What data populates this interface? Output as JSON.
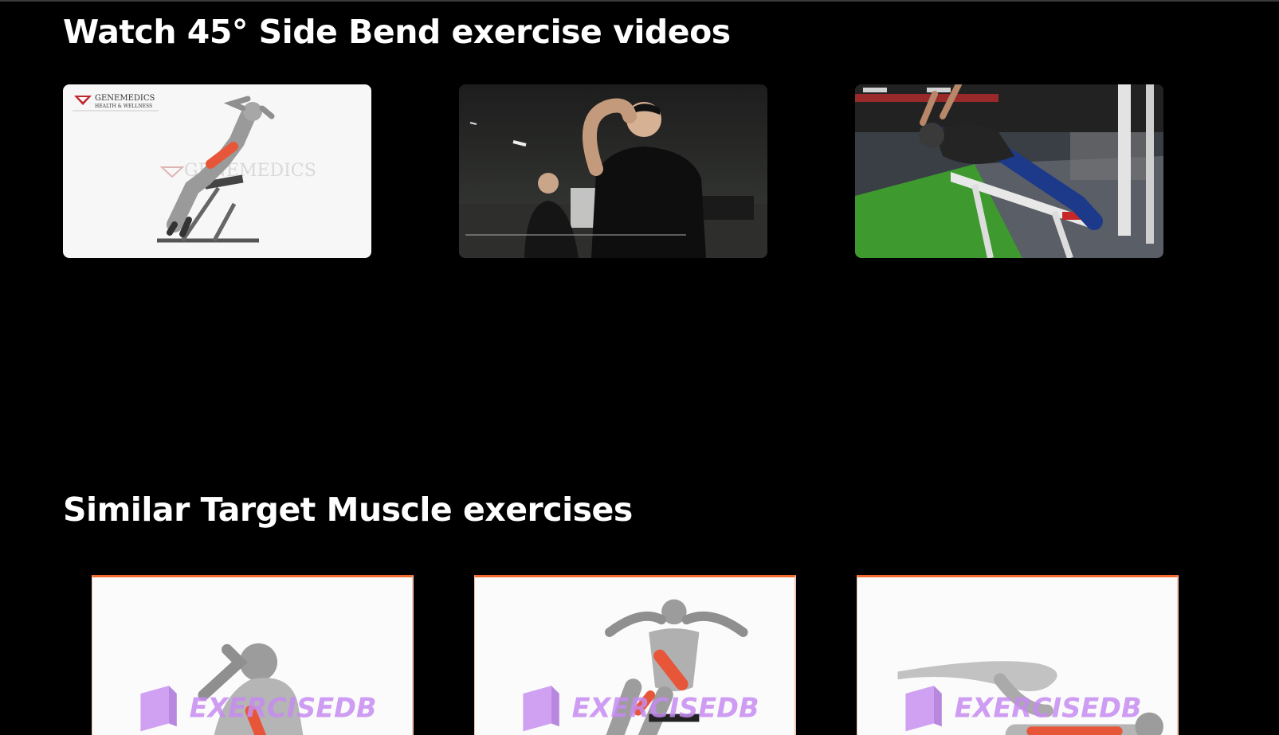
{
  "sections": {
    "videos_title": "Watch 45° Side Bend exercise videos",
    "similar_title": "Similar Target Muscle exercises"
  },
  "videos": [
    {
      "logo_text": "GENEMEDICS",
      "logo_sub": "HEALTH & WELLNESS",
      "watermark": "GENEMEDICS"
    },
    {},
    {}
  ],
  "exercise_cards": [
    {
      "watermark": "EXERCISEDB"
    },
    {
      "watermark": "EXERCISEDB"
    },
    {
      "watermark": "EXERCISEDB"
    }
  ],
  "colors": {
    "background": "#000000",
    "card_accent": "#f26a2e",
    "watermark": "#c58bf0",
    "muscle_highlight": "#e8563a"
  }
}
